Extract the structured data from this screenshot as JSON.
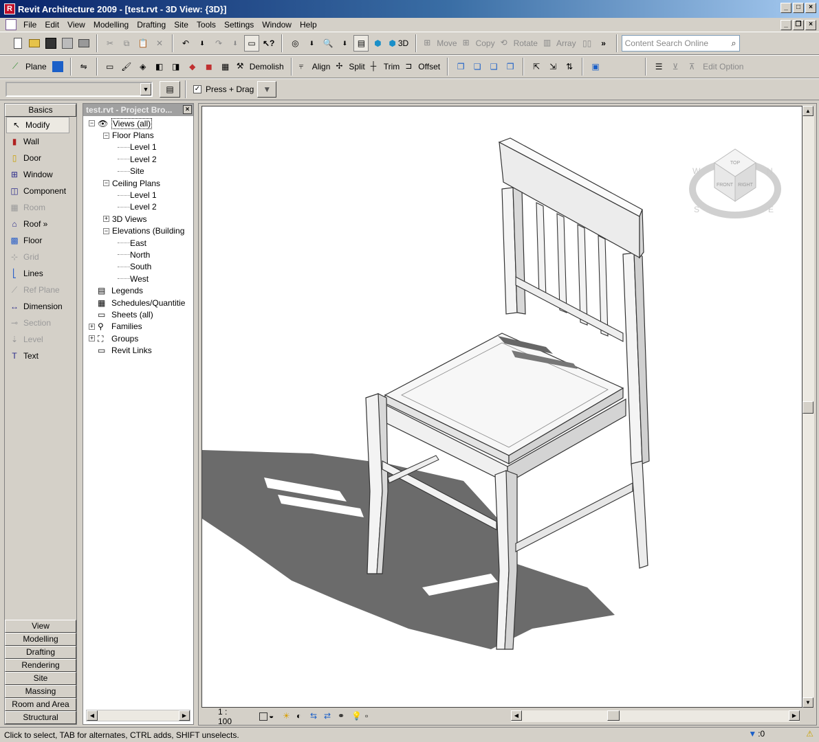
{
  "window": {
    "title": "Revit Architecture 2009 - [test.rvt - 3D View: {3D}]",
    "app_icon_letter": "R"
  },
  "menu": [
    "File",
    "Edit",
    "View",
    "Modelling",
    "Drafting",
    "Site",
    "Tools",
    "Settings",
    "Window",
    "Help"
  ],
  "toolbar1": {
    "three_d_label": "3D",
    "move": "Move",
    "copy": "Copy",
    "rotate": "Rotate",
    "array": "Array",
    "overflow": "»",
    "search_placeholder": "Content Search Online"
  },
  "toolbar2": {
    "plane": "Plane",
    "demolish": "Demolish",
    "align": "Align",
    "split": "Split",
    "trim": "Trim",
    "offset": "Offset",
    "edit_option": "Edit Option"
  },
  "toolbar3": {
    "press_drag": "Press + Drag",
    "press_drag_checked": true
  },
  "design_bar": {
    "active_tab": "Basics",
    "items": [
      {
        "label": "Modify",
        "icon": "cursor-arrow-icon",
        "enabled": true,
        "selected": true
      },
      {
        "label": "Wall",
        "icon": "wall-icon",
        "enabled": true
      },
      {
        "label": "Door",
        "icon": "door-icon",
        "enabled": true
      },
      {
        "label": "Window",
        "icon": "window-icon",
        "enabled": true
      },
      {
        "label": "Component",
        "icon": "component-icon",
        "enabled": true
      },
      {
        "label": "Room",
        "icon": "room-icon",
        "enabled": false
      },
      {
        "label": "Roof »",
        "icon": "roof-icon",
        "enabled": true
      },
      {
        "label": "Floor",
        "icon": "floor-icon",
        "enabled": true
      },
      {
        "label": "Grid",
        "icon": "grid-icon",
        "enabled": false
      },
      {
        "label": "Lines",
        "icon": "lines-icon",
        "enabled": true
      },
      {
        "label": "Ref Plane",
        "icon": "ref-plane-icon",
        "enabled": false
      },
      {
        "label": "Dimension",
        "icon": "dimension-icon",
        "enabled": true
      },
      {
        "label": "Section",
        "icon": "section-icon",
        "enabled": false
      },
      {
        "label": "Level",
        "icon": "level-icon",
        "enabled": false
      },
      {
        "label": "Text",
        "icon": "text-icon",
        "enabled": true
      }
    ],
    "bottom_tabs": [
      "View",
      "Modelling",
      "Drafting",
      "Rendering",
      "Site",
      "Massing",
      "Room and Area",
      "Structural"
    ]
  },
  "project_browser": {
    "title": "test.rvt - Project Bro...",
    "tree": [
      {
        "label": "Views (all)",
        "level": 0,
        "expander": "−",
        "icon": "eye-icon",
        "selected": true
      },
      {
        "label": "Floor Plans",
        "level": 1,
        "expander": "−"
      },
      {
        "label": "Level 1",
        "level": 2
      },
      {
        "label": "Level 2",
        "level": 2
      },
      {
        "label": "Site",
        "level": 2
      },
      {
        "label": "Ceiling Plans",
        "level": 1,
        "expander": "−"
      },
      {
        "label": "Level 1",
        "level": 2
      },
      {
        "label": "Level 2",
        "level": 2
      },
      {
        "label": "3D Views",
        "level": 1,
        "expander": "+"
      },
      {
        "label": "Elevations (Building",
        "level": 1,
        "expander": "−"
      },
      {
        "label": "East",
        "level": 2
      },
      {
        "label": "North",
        "level": 2
      },
      {
        "label": "South",
        "level": 2
      },
      {
        "label": "West",
        "level": 2
      },
      {
        "label": "Legends",
        "level": 0,
        "icon": "legend-icon"
      },
      {
        "label": "Schedules/Quantitie",
        "level": 0,
        "icon": "schedule-icon"
      },
      {
        "label": "Sheets (all)",
        "level": 0,
        "icon": "sheet-icon"
      },
      {
        "label": "Families",
        "level": 0,
        "expander": "+",
        "icon": "families-icon"
      },
      {
        "label": "Groups",
        "level": 0,
        "expander": "+",
        "icon": "groups-icon"
      },
      {
        "label": "Revit Links",
        "level": 0,
        "icon": "links-icon"
      }
    ]
  },
  "view": {
    "scale": "1 : 100",
    "viewcube": {
      "top": "TOP",
      "front": "FRONT",
      "right": "RIGHT",
      "n": "N",
      "e": "E",
      "s": "S",
      "w": "W"
    },
    "model": "chair-3d-model"
  },
  "status": {
    "message": "Click to select, TAB for alternates, CTRL adds, SHIFT unselects.",
    "filter_count": ":0"
  }
}
